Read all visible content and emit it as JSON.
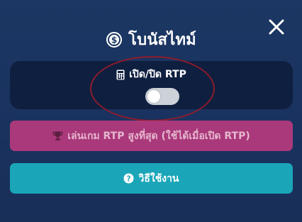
{
  "modal": {
    "title": "โบนัสไทม์",
    "close_icon": "close-icon",
    "title_icon": "dollar-coin-icon"
  },
  "rtp_toggle": {
    "label": "เปิด/ปิด RTP",
    "icon": "calculator-icon",
    "state": "off"
  },
  "buttons": {
    "top_rtp_games": {
      "label": "เล่นเกม RTP สูงที่สุด (ใช้ได้เมื่อเปิด RTP)",
      "icon": "trophy-icon",
      "color": "#a9397a"
    },
    "how_to": {
      "label": "วิธีใช้งาน",
      "icon": "question-circle-icon",
      "color": "#1aa6b8"
    }
  },
  "colors": {
    "background": "#1c3763",
    "card": "#0f1f40",
    "highlight": "#8e1c2c"
  }
}
